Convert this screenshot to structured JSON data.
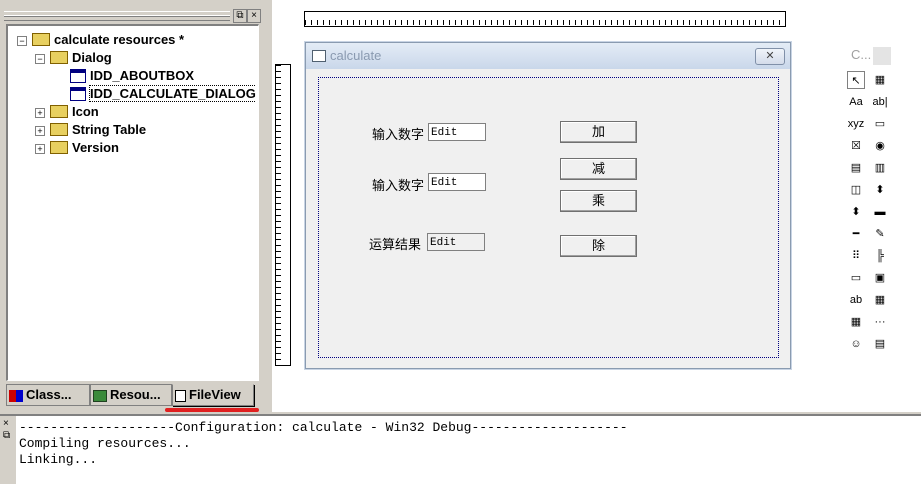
{
  "workspace": {
    "tree": {
      "root": "calculate resources *",
      "dialog_folder": "Dialog",
      "dialogs": [
        "IDD_ABOUTBOX",
        "IDD_CALCULATE_DIALOG"
      ],
      "icon_folder": "Icon",
      "stringtable_folder": "String Table",
      "version_folder": "Version"
    },
    "tabs": [
      "Class...",
      "Resou...",
      "FileView"
    ],
    "active_tab": "FileView",
    "close_glyph": "×",
    "restore_glyph": "⧉"
  },
  "dialog": {
    "caption": "calculate",
    "close_glyph": "✕",
    "labels": [
      "输入数字",
      "输入数字",
      "运算结果"
    ],
    "edit_texts": [
      "Edit",
      "Edit",
      "Edit"
    ],
    "buttons": [
      "加",
      "减",
      "乘",
      "除"
    ]
  },
  "palette": {
    "title": "C...",
    "icons": [
      "pointer-icon",
      "picture-icon",
      "static-text-icon",
      "edit-box-icon",
      "group-box-icon",
      "button-icon",
      "check-box-icon",
      "radio-button-icon",
      "combo-box-icon",
      "list-box-icon",
      "horizontal-scroll-icon",
      "vertical-scroll-icon",
      "spin-icon",
      "progress-icon",
      "slider-icon",
      "hotkey-icon",
      "list-control-icon",
      "tree-control-icon",
      "tab-control-icon",
      "animate-icon",
      "rich-edit-icon",
      "date-time-icon",
      "month-calendar-icon",
      "ip-address-icon",
      "custom-control-icon",
      "extended-combo-icon"
    ],
    "glyphs": [
      "↖",
      "▦",
      "Aa",
      "ab|",
      "xyz",
      "▭",
      "☒",
      "◉",
      "▤",
      "▥",
      "◫",
      "⬍",
      "⬍",
      "▬",
      "━",
      "✎",
      "⠿",
      "╠",
      "▭",
      "▣",
      "ab",
      "▦",
      "▦",
      "···",
      "☺",
      "▤"
    ]
  },
  "output": {
    "lines": [
      "--------------------Configuration: calculate - Win32 Debug--------------------",
      "Compiling resources...",
      "Linking..."
    ]
  },
  "colors": {
    "annotation_underline": "#e02020",
    "dialog_title_gradient": "#c9d7ea"
  }
}
